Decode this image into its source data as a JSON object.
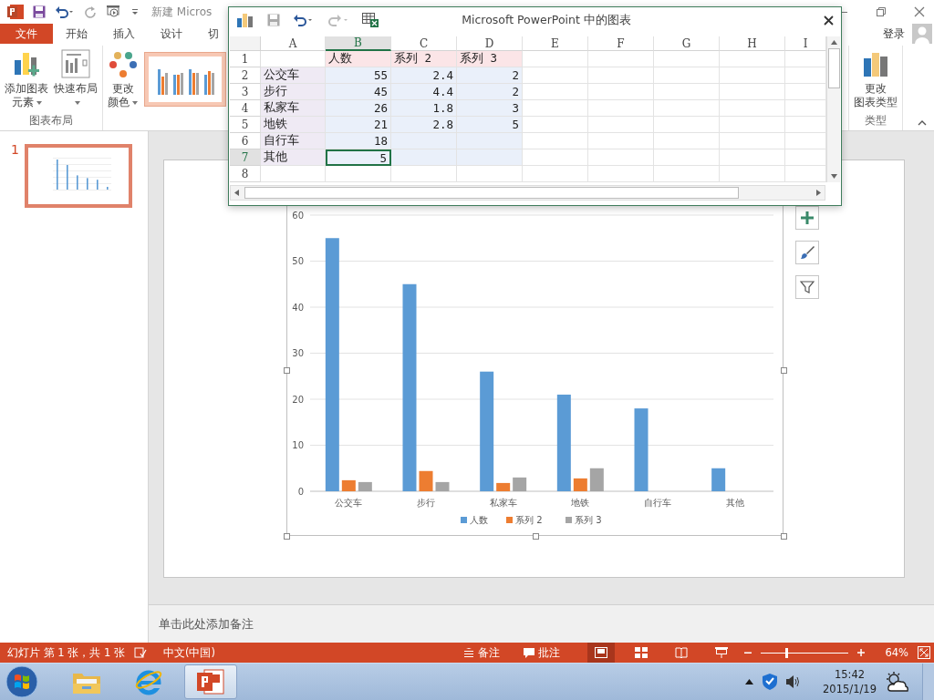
{
  "titlebar": {
    "title": "新建 Micros"
  },
  "tabs": [
    {
      "label": "文件",
      "kind": "file"
    },
    {
      "label": "开始",
      "kind": "tab"
    },
    {
      "label": "插入",
      "kind": "tab"
    },
    {
      "label": "设计",
      "kind": "tab"
    },
    {
      "label": "切",
      "kind": "tab"
    }
  ],
  "account": {
    "label": "登录"
  },
  "ribbon": {
    "left_groups": [
      {
        "label": "图表布局",
        "buttons": [
          {
            "kind": "add-element",
            "lines": [
              "添加图表",
              "元素"
            ],
            "dropdown": true
          },
          {
            "kind": "quick-layout",
            "lines": [
              "快速布局"
            ],
            "dropdown": true
          }
        ]
      },
      {
        "buttons": [
          {
            "kind": "colors",
            "lines": [
              "更改",
              "颜色"
            ],
            "dropdown": true
          },
          {
            "kind": "style",
            "selected": true
          }
        ]
      }
    ],
    "right_groups": [
      {
        "label": "类型",
        "buttons": [
          {
            "kind": "change-type",
            "lines": [
              "更改",
              "图表类型"
            ]
          }
        ]
      }
    ]
  },
  "slides": [
    {
      "number": "1",
      "selected": true
    }
  ],
  "chart": {
    "chart_data": {
      "type": "bar",
      "categories": [
        "公交车",
        "步行",
        "私家车",
        "地铁",
        "自行车",
        "其他"
      ],
      "series": [
        {
          "name": "人数",
          "color": "#5b9bd5",
          "values": [
            55,
            45,
            26,
            21,
            18,
            5
          ]
        },
        {
          "name": "系列 2",
          "color": "#ed7d31",
          "values": [
            2.4,
            4.4,
            1.8,
            2.8,
            null,
            null
          ]
        },
        {
          "name": "系列 3",
          "color": "#a5a5a5",
          "values": [
            2,
            2,
            3,
            5,
            null,
            null
          ]
        }
      ],
      "ylim": [
        0,
        60
      ],
      "yticks": [
        0,
        10,
        20,
        30,
        40,
        50,
        60
      ],
      "grid": true,
      "legend": true
    }
  },
  "notes": {
    "placeholder": "单击此处添加备注"
  },
  "status_bar": {
    "slide_info": "幻灯片 第 1 张，共 1 张",
    "language": "中文(中国)",
    "notes": "备注",
    "comments": "批注",
    "views": [
      {
        "kind": "normal",
        "selected": true
      },
      {
        "kind": "sorter",
        "selected": false
      },
      {
        "kind": "reading",
        "selected": false
      },
      {
        "kind": "slideshow",
        "selected": false
      }
    ],
    "zoom": {
      "level": 0.3
    },
    "zoom_text": "64%"
  },
  "taskbar": {
    "apps": [
      {
        "kind": "explorer",
        "selected": false
      },
      {
        "kind": "browser",
        "selected": false
      },
      {
        "kind": "powerpoint",
        "selected": true
      }
    ],
    "time": "15:42",
    "date": "2015/1/19"
  },
  "spreadsheet": {
    "title": "Microsoft PowerPoint 中的图表",
    "columns": [
      {
        "label": "A",
        "selected": false
      },
      {
        "label": "B",
        "selected": true
      },
      {
        "label": "C",
        "selected": false
      },
      {
        "label": "D",
        "selected": false
      },
      {
        "label": "E",
        "selected": false
      },
      {
        "label": "F",
        "selected": false
      },
      {
        "label": "G",
        "selected": false
      },
      {
        "label": "H",
        "selected": false
      },
      {
        "label": "I",
        "selected": false
      }
    ],
    "rows": [
      {
        "number": "1",
        "selected": false,
        "cells": [
          null,
          "人数",
          "系列 2",
          "系列 3"
        ]
      },
      {
        "number": "2",
        "selected": false,
        "cells": [
          "公交车",
          "55",
          "2.4",
          "2"
        ]
      },
      {
        "number": "3",
        "selected": false,
        "cells": [
          "步行",
          "45",
          "4.4",
          "2"
        ]
      },
      {
        "number": "4",
        "selected": false,
        "cells": [
          "私家车",
          "26",
          "1.8",
          "3"
        ]
      },
      {
        "number": "5",
        "selected": false,
        "cells": [
          "地铁",
          "21",
          "2.8",
          "5"
        ]
      },
      {
        "number": "6",
        "selected": false,
        "cells": [
          "自行车",
          "18",
          null,
          null
        ]
      },
      {
        "number": "7",
        "selected": true,
        "cells": [
          "其他",
          "5",
          null,
          null
        ]
      },
      {
        "number": "8",
        "selected": false
      }
    ]
  }
}
